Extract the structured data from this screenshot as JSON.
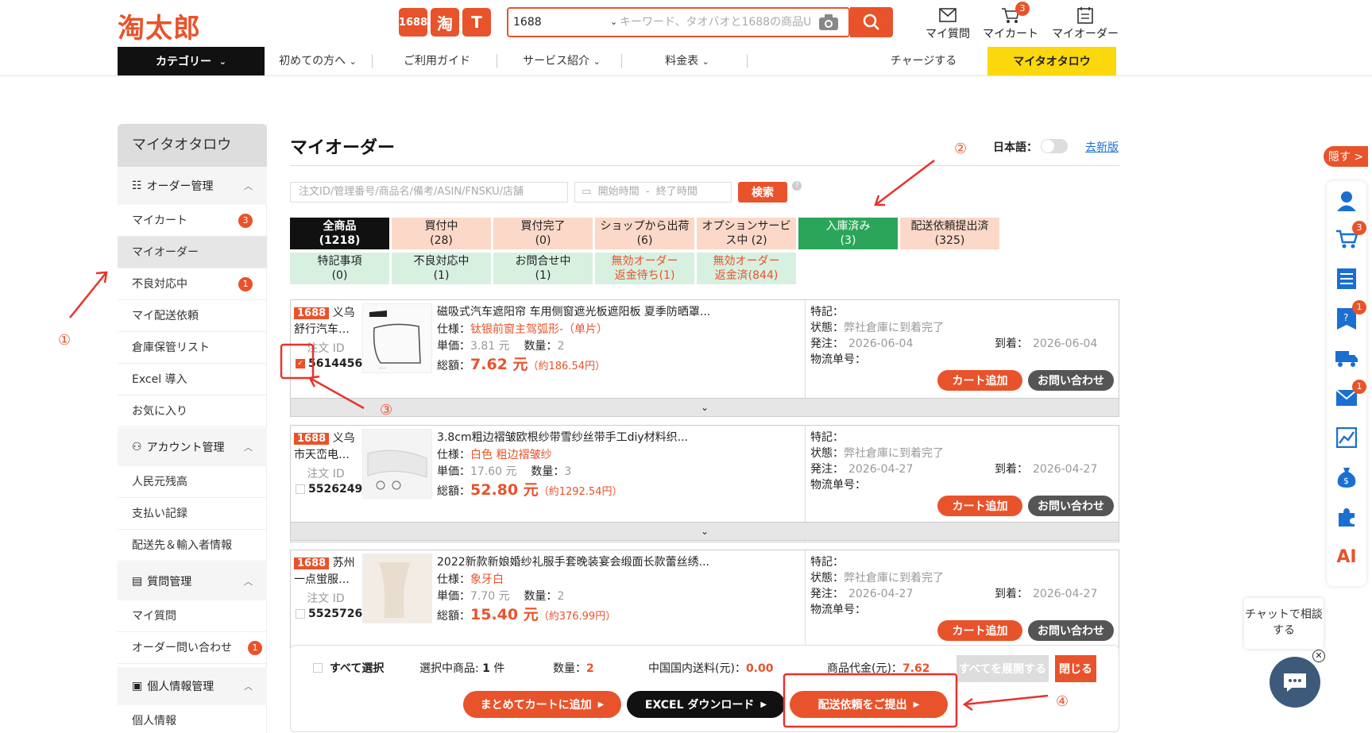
{
  "header": {
    "logo": "淘太郎",
    "platforms": [
      "1688",
      "淘",
      "T"
    ],
    "search": {
      "selected": "1688",
      "placeholder": "キーワード、タオバオと1688の商品URL"
    },
    "icons": [
      {
        "label": "マイ質問",
        "icon": "mail-icon"
      },
      {
        "label": "マイカート",
        "icon": "cart-icon",
        "badge": "3"
      },
      {
        "label": "マイオーダー",
        "icon": "order-list-icon"
      }
    ]
  },
  "nav": {
    "category": "カテゴリー",
    "items": [
      "初めての方へ",
      "ご利用ガイド",
      "サービス紹介",
      "料金表"
    ],
    "charge": "チャージする",
    "mypage": "マイタオタロウ"
  },
  "sidebar": {
    "title": "マイタオタロウ",
    "sections": [
      {
        "label": "オーダー管理",
        "items": [
          {
            "label": "マイカート",
            "badge": "3"
          },
          {
            "label": "マイオーダー",
            "active": true
          },
          {
            "label": "不良対応中",
            "badge": "1"
          },
          {
            "label": "マイ配送依頼"
          },
          {
            "label": "倉庫保管リスト"
          },
          {
            "label": "Excel 導入"
          },
          {
            "label": "お気に入り"
          }
        ]
      },
      {
        "label": "アカウント管理",
        "items": [
          {
            "label": "人民元残高"
          },
          {
            "label": "支払い記録"
          },
          {
            "label": "配送先＆輸入者情報"
          }
        ]
      },
      {
        "label": "質問管理",
        "items": [
          {
            "label": "マイ質問"
          },
          {
            "label": "オーダー問い合わせ",
            "badge": "1"
          }
        ]
      },
      {
        "label": "個人情報管理",
        "items": [
          {
            "label": "個人情報"
          }
        ]
      }
    ]
  },
  "main": {
    "title": "マイオーダー",
    "lang_label": "日本語：",
    "old_version": "去新版",
    "filter": {
      "placeholder": "注文ID/管理番号/商品名/備考/ASIN/FNSKU/店舗",
      "date_start": "開始時間",
      "date_sep": "-",
      "date_end": "終了時間",
      "search": "検索",
      "help": "?"
    },
    "tabs_row1": [
      {
        "label": "全商品",
        "count": "(1218)",
        "style": "black"
      },
      {
        "label": "買付中",
        "count": "(28)",
        "style": "peach"
      },
      {
        "label": "買付完了",
        "count": "(0)",
        "style": "peach"
      },
      {
        "label": "ショップから出荷",
        "count": "(6)",
        "style": "peach"
      },
      {
        "label": "オプションサービス中 (2)",
        "count": "",
        "style": "peach"
      },
      {
        "label": "入庫済み",
        "count": "(3)",
        "style": "greenbold"
      },
      {
        "label": "配送依頼提出済",
        "count": "(325)",
        "style": "peach"
      }
    ],
    "tabs_row2": [
      {
        "label": "特記事項",
        "count": "(0)",
        "style": "green"
      },
      {
        "label": "不良対応中",
        "count": "(1)",
        "style": "green"
      },
      {
        "label": "お問合せ中",
        "count": "(1)",
        "style": "green"
      },
      {
        "label": "無効オーダー",
        "count": "返金待ち(1)",
        "style": "green orangeText"
      },
      {
        "label": "無効オーダー",
        "count": "返金済(844)",
        "style": "green orangeText"
      }
    ],
    "orders": [
      {
        "platform": "1688",
        "shop": "义乌舒行汽车…",
        "id_label": "注文 ID",
        "id": "5614456",
        "checked": true,
        "name": "磁吸式汽车遮阳帘 车用侧窗遮光板遮阳板 夏季防晒罩...",
        "spec_label": "仕様：",
        "spec": "钛银前窗主驾弧形-（单片）",
        "price_label": "単価：",
        "price": "3.81 元",
        "qty_label": "数量：",
        "qty": "2",
        "total_label": "総額：",
        "total": "7.62 元",
        "total_jpy": "（約186.54円）",
        "note_label": "特記：",
        "status_label": "状態：",
        "status": "弊社倉庫に到着完了",
        "ship_label": "発注：",
        "ship": "2026-06-04",
        "arrive_label": "到着：",
        "arrive": "2026-06-04",
        "tracking_label": "物流单号：",
        "cart_btn": "カート追加",
        "ask_btn": "お問い合わせ"
      },
      {
        "platform": "1688",
        "shop": "义乌市天峦电…",
        "id_label": "注文 ID",
        "id": "5526249",
        "checked": false,
        "name": "3.8cm粗边褶皱欧根纱带雪纱丝带手工diy材料织...",
        "spec_label": "仕様：",
        "spec": "白色 粗边褶皱纱",
        "price_label": "単価：",
        "price": "17.60 元",
        "qty_label": "数量：",
        "qty": "3",
        "total_label": "総額：",
        "total": "52.80 元",
        "total_jpy": "（約1292.54円）",
        "note_label": "特記：",
        "status_label": "状態：",
        "status": "弊社倉庫に到着完了",
        "ship_label": "発注：",
        "ship": "2026-04-27",
        "arrive_label": "到着：",
        "arrive": "2026-04-27",
        "tracking_label": "物流单号：",
        "cart_btn": "カート追加",
        "ask_btn": "お問い合わせ"
      },
      {
        "platform": "1688",
        "shop": "苏州一点蛍服…",
        "id_label": "注文 ID",
        "id": "5525726",
        "checked": false,
        "name": "2022新款新娘婚纱礼服手套晚装宴会缎面长款蕾丝绣...",
        "spec_label": "仕様：",
        "spec": "象牙白",
        "price_label": "単価：",
        "price": "7.70 元",
        "qty_label": "数量：",
        "qty": "2",
        "total_label": "総額：",
        "total": "15.40 元",
        "total_jpy": "（約376.99円）",
        "note_label": "特記：",
        "status_label": "状態：",
        "status": "弊社倉庫に到着完了",
        "ship_label": "発注：",
        "ship": "2026-04-27",
        "arrive_label": "到着：",
        "arrive": "2026-04-27",
        "tracking_label": "物流单号：",
        "cart_btn": "カート追加",
        "ask_btn": "お問い合わせ"
      }
    ],
    "bottom": {
      "select_all": "すべて選択",
      "selected_label": "選択中商品:",
      "selected_count": "1",
      "selected_unit": "件",
      "qty_label": "数量：",
      "qty": "2",
      "ship_label": "中国国内送料(元)：",
      "ship": "0.00",
      "goods_label": "商品代金(元)：",
      "goods": "7.62",
      "expand_all": "すべてを展開する",
      "close": "閉じる",
      "btn_cart": "まとめてカートに追加",
      "btn_excel": "EXCEL ダウンロード",
      "btn_submit": "配送依頼をご提出"
    }
  },
  "right": {
    "hide": "隠す >",
    "badges": {
      "cart": "3",
      "question": "1",
      "mail": "1"
    },
    "ai": "AI",
    "chat": "チャットで相談する"
  },
  "annotations": [
    "①",
    "②",
    "③",
    "④"
  ],
  "colors": {
    "accent": "#e8532b",
    "yellow": "#fbd80b",
    "green": "#2aa55a",
    "dark": "#111111"
  }
}
